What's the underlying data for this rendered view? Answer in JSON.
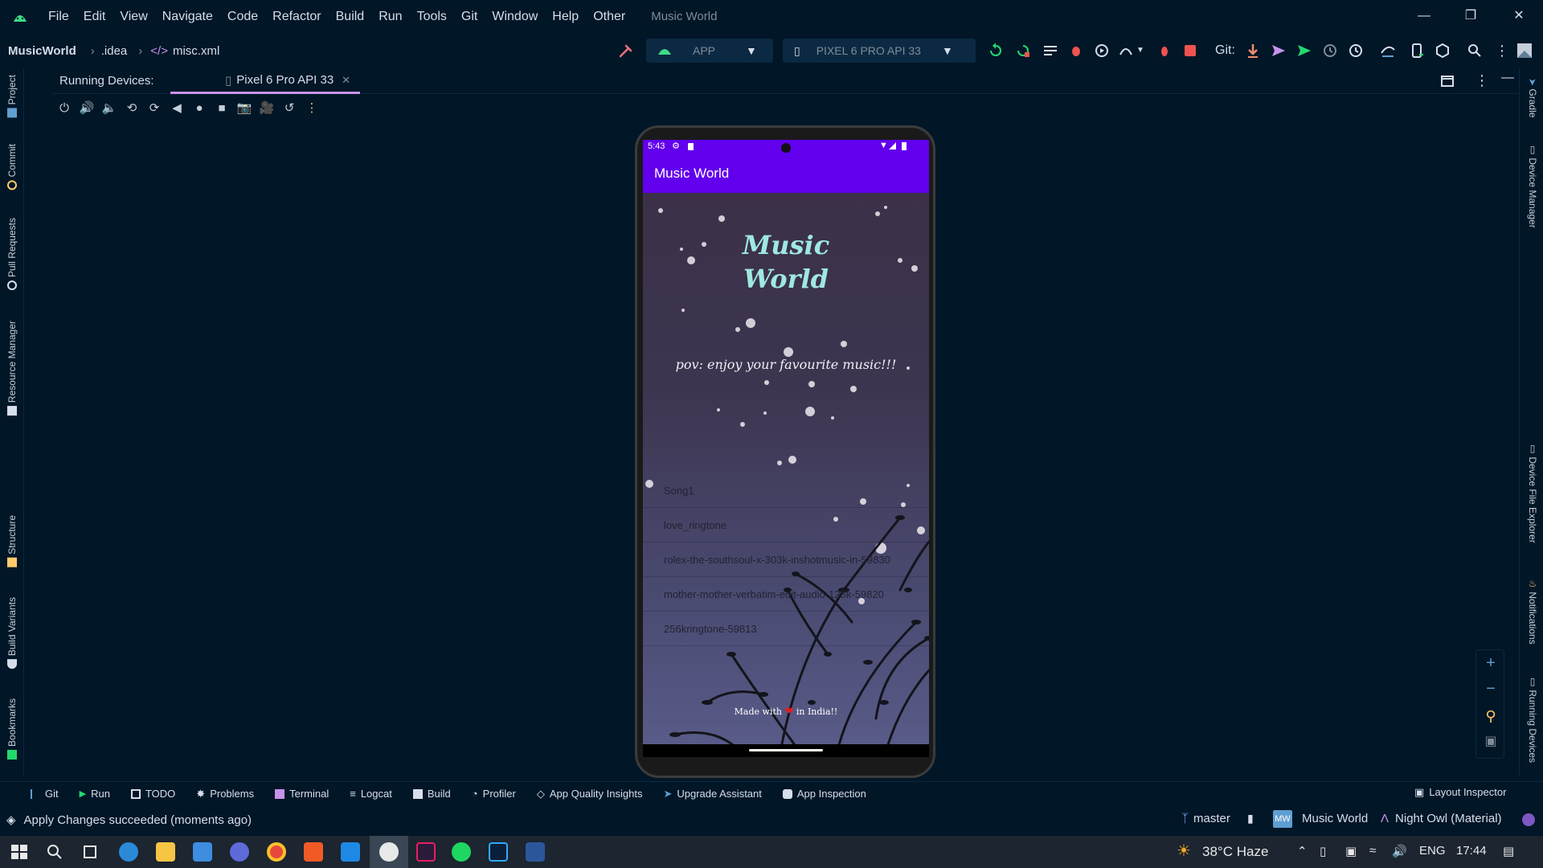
{
  "menubar": {
    "items": [
      "File",
      "Edit",
      "View",
      "Navigate",
      "Code",
      "Refactor",
      "Build",
      "Run",
      "Tools",
      "Git",
      "Window",
      "Help",
      "Other"
    ],
    "app_title": "Music World"
  },
  "navbar": {
    "project": "MusicWorld",
    "crumb1": ".idea",
    "crumb2": "misc.xml",
    "run_config": "APP",
    "device": "PIXEL 6 PRO API 33",
    "git_label": "Git:"
  },
  "left_tabs": [
    "Project",
    "Commit",
    "Pull Requests",
    "Resource Manager",
    "Structure",
    "Build Variants",
    "Bookmarks"
  ],
  "right_tabs": [
    "Gradle",
    "Device Manager",
    "Device File Explorer",
    "Notifications",
    "Running Devices"
  ],
  "running_devices": {
    "label": "Running Devices:",
    "tab": "Pixel 6 Pro API 33"
  },
  "phone": {
    "time": "5:43",
    "app_bar_title": "Music World",
    "hero_title_line1": "Music",
    "hero_title_line2": "World",
    "tagline": "pov: enjoy your favourite music!!!",
    "songs": [
      "Song1",
      "love_ringtone",
      "rolex-the-southsoul-x-303k-inshotmusic-in-59830",
      "mother-mother-verbatim-edit-audio-128k-59820",
      "256kringtone-59813"
    ],
    "made_with": "Made with",
    "made_with_suffix": "in India!!"
  },
  "bottom_tabs": [
    "Git",
    "Run",
    "TODO",
    "Problems",
    "Terminal",
    "Logcat",
    "Build",
    "Profiler",
    "App Quality Insights",
    "Upgrade Assistant",
    "App Inspection"
  ],
  "layout_inspector": "Layout Inspector",
  "status": {
    "message": "Apply Changes succeeded (moments ago)",
    "branch": "master",
    "project_badge": "MW",
    "project_name": "Music World",
    "theme": "Night Owl (Material)"
  },
  "taskbar": {
    "weather": "38°C Haze",
    "lang": "ENG",
    "clock": "17:44"
  },
  "colors": {
    "ide_bg": "#011627",
    "accent": "#c792ea",
    "app_purple": "#6200ee",
    "title_teal": "#9fe8e0",
    "stop_red": "#ef5350",
    "run_green": "#22da6e"
  }
}
